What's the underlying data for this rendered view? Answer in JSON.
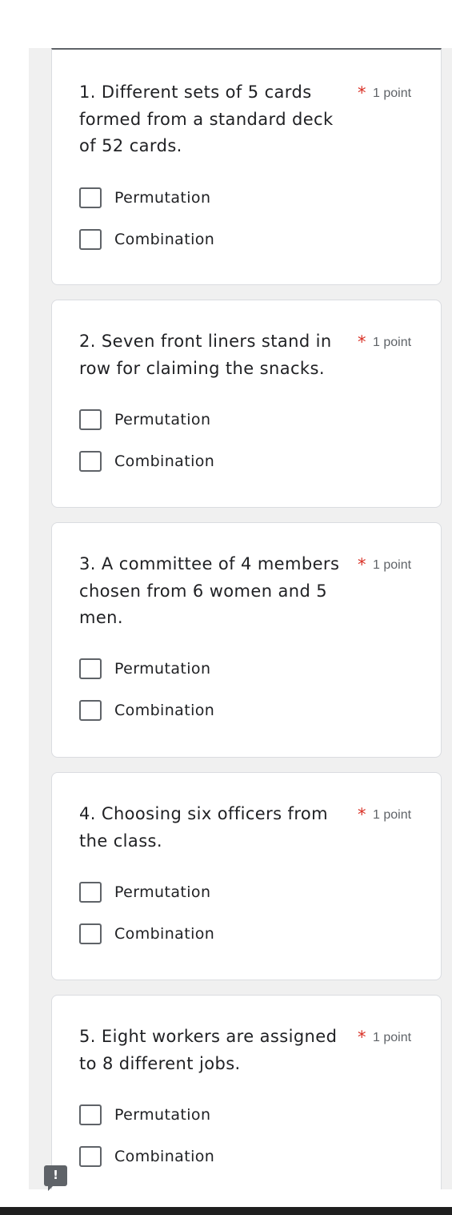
{
  "questions": [
    {
      "title": "1.  Different sets of 5 cards formed from a standard deck of 52  cards.",
      "required_marker": "*",
      "points": "1 point",
      "options": [
        "Permutation",
        "Combination"
      ]
    },
    {
      "title": "2.  Seven front liners stand in row for claiming the snacks.",
      "required_marker": "*",
      "points": "1 point",
      "options": [
        "Permutation",
        "Combination"
      ]
    },
    {
      "title": "3.  A committee of 4 members chosen from 6 women and 5 men.",
      "required_marker": "*",
      "points": "1 point",
      "options": [
        "Permutation",
        "Combination"
      ]
    },
    {
      "title": "4.  Choosing six officers from the class.",
      "required_marker": "*",
      "points": "1 point",
      "options": [
        "Permutation",
        "Combination"
      ]
    },
    {
      "title": "5.  Eight workers are assigned to 8 different jobs.",
      "required_marker": "*",
      "points": "1 point",
      "options": [
        "Permutation",
        "Combination"
      ]
    }
  ],
  "feedback": {
    "icon": "feedback-icon",
    "glyph": "!"
  },
  "colors": {
    "required": "#d93025",
    "checkbox_border": "#5f6368",
    "page_background": "#f0f0f0"
  }
}
